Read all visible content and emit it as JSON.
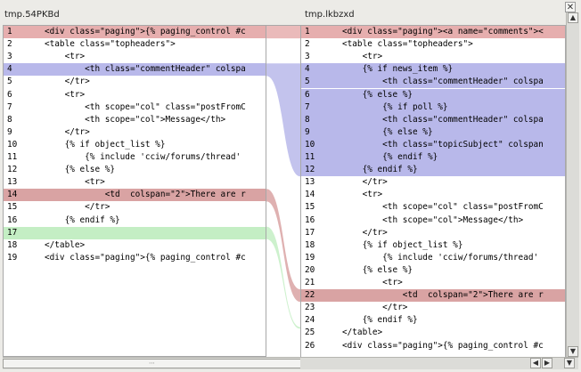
{
  "left_file": "tmp.54PKBd",
  "right_file": "tmp.lkbzxd",
  "colors": {
    "deleted": "#e6aeae",
    "changed": "#b8b8ea",
    "inserted": "#c4eec4",
    "current": "#d9a3a3"
  },
  "left_lines": [
    {
      "n": "1",
      "code": "<div class=\"paging\">{% paging_control #c"
    },
    {
      "n": "2",
      "code": "<table class=\"topheaders\">"
    },
    {
      "n": "3",
      "code": "    <tr>"
    },
    {
      "n": "4",
      "code": "        <th class=\"commentHeader\" colspa"
    },
    {
      "n": "5",
      "code": "    </tr>"
    },
    {
      "n": "6",
      "code": "    <tr>"
    },
    {
      "n": "7",
      "code": "        <th scope=\"col\" class=\"postFromC"
    },
    {
      "n": "8",
      "code": "        <th scope=\"col\">Message</th>"
    },
    {
      "n": "9",
      "code": "    </tr>"
    },
    {
      "n": "10",
      "code": "    {% if object_list %}"
    },
    {
      "n": "11",
      "code": "        {% include 'cciw/forums/thread'"
    },
    {
      "n": "12",
      "code": "    {% else %}"
    },
    {
      "n": "13",
      "code": "        <tr>"
    },
    {
      "n": "14",
      "code": "            <td  colspan=\"2\">There are r"
    },
    {
      "n": "15",
      "code": "        </tr>"
    },
    {
      "n": "16",
      "code": "    {% endif %}"
    },
    {
      "n": "17",
      "code": ""
    },
    {
      "n": "18",
      "code": "</table>"
    },
    {
      "n": "19",
      "code": "<div class=\"paging\">{% paging_control #c"
    }
  ],
  "right_lines": [
    {
      "n": "1",
      "code": "<div class=\"paging\"><a name=\"comments\"><"
    },
    {
      "n": "2",
      "code": "<table class=\"topheaders\">"
    },
    {
      "n": "3",
      "code": "    <tr>"
    },
    {
      "n": "4",
      "code": "    {% if news_item %}"
    },
    {
      "n": "5",
      "code": "        <th class=\"commentHeader\" colspa"
    },
    {
      "n": "6",
      "code": "    {% else %}"
    },
    {
      "n": "7",
      "code": "        {% if poll %}"
    },
    {
      "n": "8",
      "code": "        <th class=\"commentHeader\" colspa"
    },
    {
      "n": "9",
      "code": "        {% else %}"
    },
    {
      "n": "10",
      "code": "        <th class=\"topicSubject\" colspan"
    },
    {
      "n": "11",
      "code": "        {% endif %}"
    },
    {
      "n": "12",
      "code": "    {% endif %}"
    },
    {
      "n": "13",
      "code": "    </tr>"
    },
    {
      "n": "14",
      "code": "    <tr>"
    },
    {
      "n": "15",
      "code": "        <th scope=\"col\" class=\"postFromC"
    },
    {
      "n": "16",
      "code": "        <th scope=\"col\">Message</th>"
    },
    {
      "n": "17",
      "code": "    </tr>"
    },
    {
      "n": "18",
      "code": "    {% if object_list %}"
    },
    {
      "n": "19",
      "code": "        {% include 'cciw/forums/thread'"
    },
    {
      "n": "20",
      "code": "    {% else %}"
    },
    {
      "n": "21",
      "code": "        <tr>"
    },
    {
      "n": "22",
      "code": "            <td  colspan=\"2\">There are r"
    },
    {
      "n": "23",
      "code": "        </tr>"
    },
    {
      "n": "24",
      "code": "    {% endif %}"
    },
    {
      "n": "25",
      "code": "</table>"
    },
    {
      "n": "26",
      "code": "<div class=\"paging\">{% paging_control #c"
    }
  ]
}
